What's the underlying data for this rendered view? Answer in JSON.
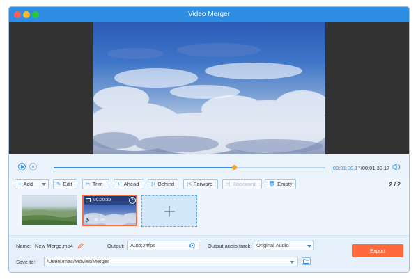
{
  "window": {
    "title": "Video Merger",
    "colors": {
      "titlebar": "#2d8de3",
      "accent": "#2d8de3",
      "export": "#ff6a3c",
      "progress_knob": "#f5a623"
    }
  },
  "traffic_lights": [
    {
      "name": "close",
      "color": "#fc5f57"
    },
    {
      "name": "minimize",
      "color": "#fdbc2e"
    },
    {
      "name": "maximize",
      "color": "#29c840"
    }
  ],
  "playback": {
    "current_time": "00:01:00.17",
    "separator": "/",
    "total_time": "00:01:30.17",
    "progress": 0.665
  },
  "toolbar": {
    "add": "Add",
    "edit": "Edit",
    "trim": "Trim",
    "ahead": "Ahead",
    "behind": "Behind",
    "forward": "Forward",
    "backward": "Backward",
    "empty": "Empty",
    "page_current": "2",
    "page_sep": "/",
    "page_total": "2"
  },
  "clips": {
    "selected_duration": "00:00:30"
  },
  "settings": {
    "name_label": "Name:",
    "name_value": "New Merge.mp4",
    "output_label": "Output:",
    "output_value": "Auto;24fps",
    "audio_label": "Output audio track:",
    "audio_value": "Original Audio",
    "save_label": "Save to:",
    "save_path": "/Users/mac/Movies/Merger",
    "export": "Export"
  }
}
